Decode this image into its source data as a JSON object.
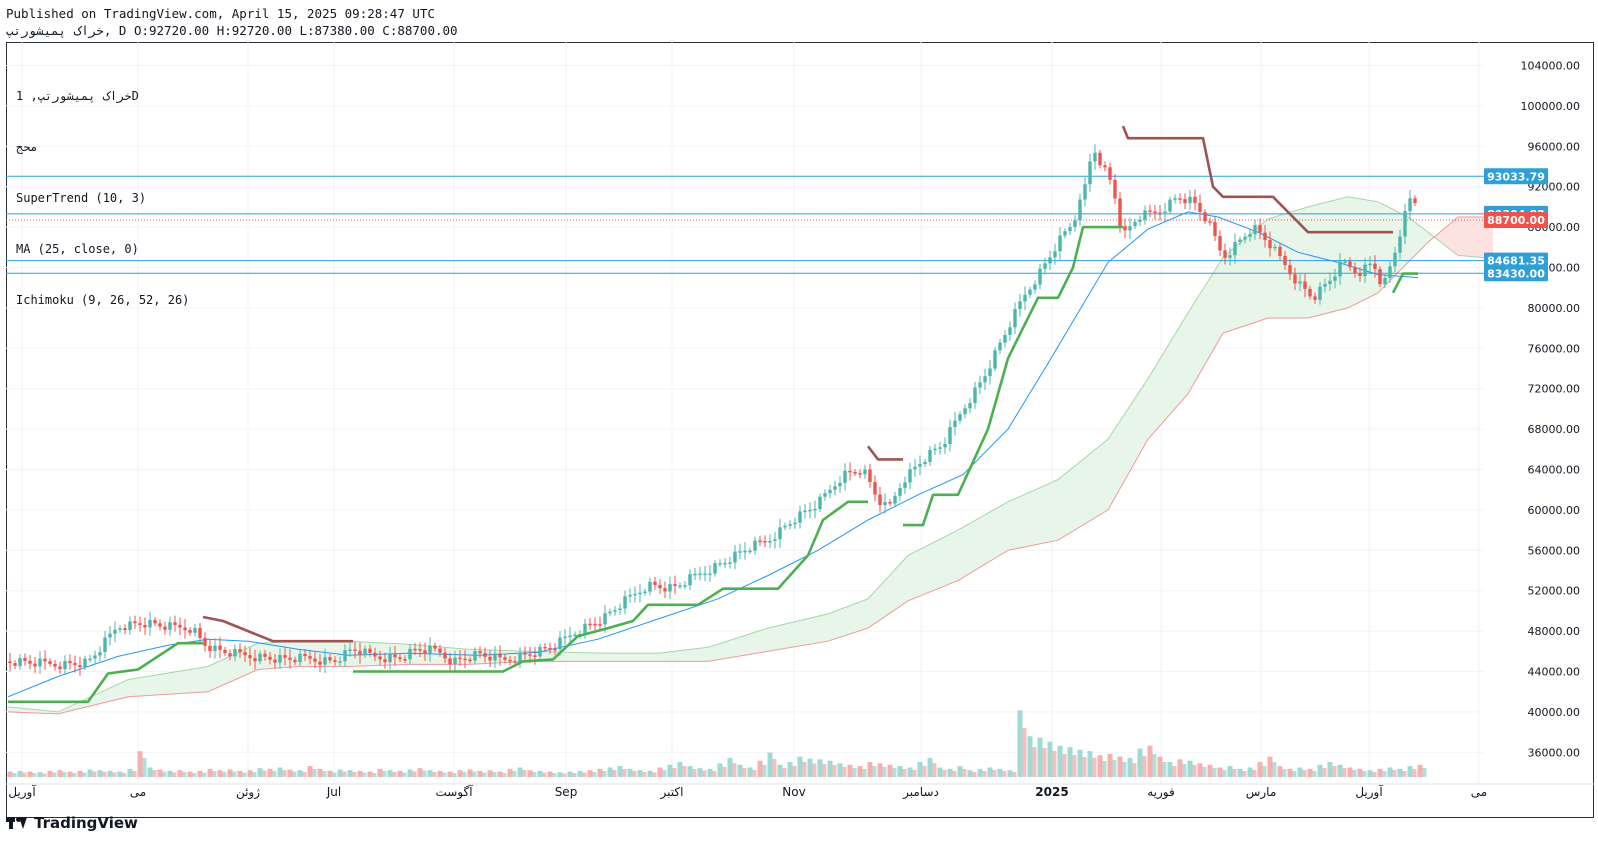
{
  "header": {
    "published": "Published on TradingView.com, April 15, 2025 09:28:47 UTC",
    "ohlc": "خراک پمیشورتپ, D O:92720.00 H:92720.00 L:87380.00 C:88700.00"
  },
  "legend": {
    "symbol": "خراک پمیشورتپ, 1D",
    "symbol_sub": "محج",
    "indicators": [
      "SuperTrend (10, 3)",
      "MA (25, close, 0)",
      "Ichimoku (9, 26, 52, 26)"
    ]
  },
  "footer": {
    "brand": "TradingView"
  },
  "colors": {
    "up": "#4db6ac",
    "down": "#ef5350",
    "supertrend_up": "#4caf50",
    "supertrend_down": "#a05353",
    "ma": "#2196f3",
    "hline": "#2f9fd8",
    "cloud_green": "#e8f5e9",
    "cloud_red": "#fde2e2"
  },
  "chart_data": {
    "type": "candlestick",
    "y_ticks": [
      104000,
      100000,
      96000,
      92000,
      88000,
      84000,
      80000,
      76000,
      72000,
      68000,
      64000,
      60000,
      56000,
      52000,
      48000,
      44000,
      40000,
      36000
    ],
    "x_labels": [
      "آوریل",
      "می",
      "ژوئن",
      "Jul",
      "آگوست",
      "Sep",
      "اکتبر",
      "Nov",
      "دسامبر",
      "2025",
      "فوریه",
      "مارس",
      "آوریل",
      "می"
    ],
    "horizontal_lines": [
      {
        "value": 93033.79,
        "label": "93033.79"
      },
      {
        "value": 89304.82,
        "label": "89304.82"
      },
      {
        "value": 84681.35,
        "label": "84681.35"
      },
      {
        "value": 83430.0,
        "label": "83430.00"
      }
    ],
    "last_price": {
      "value": 88700.0,
      "label": "88700.00"
    },
    "last_candle": {
      "open": 92720.0,
      "high": 92720.0,
      "low": 87380.0,
      "close": 88700.0
    },
    "close_series": [
      [
        0,
        45000
      ],
      [
        30,
        44800
      ],
      [
        55,
        44700
      ],
      [
        80,
        44900
      ],
      [
        90,
        46000
      ],
      [
        110,
        48500
      ],
      [
        135,
        48800
      ],
      [
        160,
        48400
      ],
      [
        185,
        48300
      ],
      [
        195,
        46800
      ],
      [
        210,
        46000
      ],
      [
        230,
        45700
      ],
      [
        255,
        45400
      ],
      [
        275,
        45200
      ],
      [
        300,
        45300
      ],
      [
        325,
        45000
      ],
      [
        345,
        46200
      ],
      [
        365,
        45500
      ],
      [
        390,
        45300
      ],
      [
        410,
        46200
      ],
      [
        430,
        46000
      ],
      [
        445,
        45000
      ],
      [
        470,
        45700
      ],
      [
        495,
        45100
      ],
      [
        520,
        45700
      ],
      [
        545,
        46400
      ],
      [
        570,
        48100
      ],
      [
        595,
        49200
      ],
      [
        620,
        51200
      ],
      [
        640,
        52600
      ],
      [
        665,
        52200
      ],
      [
        690,
        53600
      ],
      [
        715,
        54800
      ],
      [
        740,
        56200
      ],
      [
        760,
        57000
      ],
      [
        785,
        59000
      ],
      [
        810,
        60600
      ],
      [
        835,
        63500
      ],
      [
        855,
        64000
      ],
      [
        870,
        61000
      ],
      [
        880,
        60000
      ],
      [
        895,
        63000
      ],
      [
        915,
        65000
      ],
      [
        935,
        66500
      ],
      [
        955,
        70000
      ],
      [
        975,
        73000
      ],
      [
        995,
        77000
      ],
      [
        1015,
        81000
      ],
      [
        1035,
        84000
      ],
      [
        1050,
        86500
      ],
      [
        1065,
        88500
      ],
      [
        1075,
        91000
      ],
      [
        1085,
        96000
      ],
      [
        1095,
        94000
      ],
      [
        1105,
        92000
      ],
      [
        1115,
        87000
      ],
      [
        1130,
        89000
      ],
      [
        1150,
        89500
      ],
      [
        1170,
        91000
      ],
      [
        1185,
        90500
      ],
      [
        1200,
        88500
      ],
      [
        1215,
        85000
      ],
      [
        1230,
        86500
      ],
      [
        1245,
        88000
      ],
      [
        1260,
        86500
      ],
      [
        1275,
        84500
      ],
      [
        1290,
        82500
      ],
      [
        1305,
        81000
      ],
      [
        1320,
        82500
      ],
      [
        1335,
        84500
      ],
      [
        1350,
        83500
      ],
      [
        1365,
        84500
      ],
      [
        1375,
        82000
      ],
      [
        1385,
        84800
      ],
      [
        1395,
        88500
      ],
      [
        1405,
        91500
      ],
      [
        1410,
        88700
      ]
    ],
    "supertrend": [
      {
        "dir": "up",
        "points": [
          [
            0,
            41000
          ],
          [
            80,
            41000
          ],
          [
            100,
            43800
          ],
          [
            130,
            44200
          ],
          [
            170,
            46800
          ],
          [
            195,
            46800
          ]
        ]
      },
      {
        "dir": "down",
        "points": [
          [
            195,
            49400
          ],
          [
            215,
            49000
          ],
          [
            265,
            47000
          ],
          [
            345,
            47000
          ]
        ]
      },
      {
        "dir": "up",
        "points": [
          [
            345,
            44000
          ],
          [
            495,
            44000
          ],
          [
            515,
            45000
          ],
          [
            545,
            45200
          ],
          [
            570,
            47500
          ],
          [
            600,
            48300
          ],
          [
            625,
            49000
          ],
          [
            640,
            50600
          ],
          [
            690,
            50600
          ],
          [
            715,
            52200
          ],
          [
            770,
            52200
          ],
          [
            800,
            55500
          ],
          [
            815,
            59000
          ],
          [
            840,
            60800
          ],
          [
            860,
            60800
          ]
        ]
      },
      {
        "dir": "down",
        "points": [
          [
            860,
            66300
          ],
          [
            870,
            65000
          ],
          [
            895,
            65000
          ]
        ]
      },
      {
        "dir": "up",
        "points": [
          [
            895,
            58500
          ],
          [
            915,
            58500
          ],
          [
            925,
            61500
          ],
          [
            950,
            61500
          ],
          [
            980,
            68000
          ],
          [
            1000,
            75000
          ],
          [
            1030,
            81000
          ],
          [
            1050,
            81000
          ],
          [
            1065,
            84000
          ],
          [
            1075,
            88000
          ],
          [
            1085,
            88000
          ],
          [
            1115,
            88000
          ]
        ]
      },
      {
        "dir": "down",
        "points": [
          [
            1115,
            98000
          ],
          [
            1120,
            96800
          ],
          [
            1195,
            96800
          ],
          [
            1205,
            92000
          ],
          [
            1215,
            91000
          ],
          [
            1265,
            91000
          ],
          [
            1290,
            88500
          ],
          [
            1300,
            87500
          ],
          [
            1385,
            87500
          ]
        ]
      },
      {
        "dir": "up",
        "points": [
          [
            1385,
            81500
          ],
          [
            1395,
            83400
          ],
          [
            1410,
            83400
          ]
        ]
      }
    ],
    "ma_series": [
      [
        0,
        41500
      ],
      [
        50,
        43500
      ],
      [
        110,
        45500
      ],
      [
        160,
        46600
      ],
      [
        200,
        47200
      ],
      [
        240,
        47000
      ],
      [
        290,
        46200
      ],
      [
        340,
        45600
      ],
      [
        400,
        45800
      ],
      [
        470,
        45600
      ],
      [
        530,
        45900
      ],
      [
        590,
        47200
      ],
      [
        650,
        49200
      ],
      [
        710,
        51200
      ],
      [
        760,
        53500
      ],
      [
        810,
        56000
      ],
      [
        860,
        59000
      ],
      [
        910,
        61500
      ],
      [
        955,
        63500
      ],
      [
        1000,
        68000
      ],
      [
        1040,
        74500
      ],
      [
        1070,
        79500
      ],
      [
        1100,
        84500
      ],
      [
        1140,
        87800
      ],
      [
        1180,
        89500
      ],
      [
        1210,
        89000
      ],
      [
        1250,
        87500
      ],
      [
        1290,
        85500
      ],
      [
        1330,
        84500
      ],
      [
        1370,
        83300
      ],
      [
        1410,
        83000
      ]
    ],
    "ichimoku_cloud": {
      "span_a": [
        [
          0,
          40500
        ],
        [
          50,
          40000
        ],
        [
          120,
          43200
        ],
        [
          200,
          44500
        ],
        [
          250,
          46800
        ],
        [
          290,
          47000
        ],
        [
          340,
          47000
        ],
        [
          400,
          46700
        ],
        [
          460,
          46200
        ],
        [
          520,
          46000
        ],
        [
          600,
          45800
        ],
        [
          650,
          45800
        ],
        [
          700,
          46400
        ],
        [
          760,
          48300
        ],
        [
          820,
          49700
        ],
        [
          860,
          51200
        ],
        [
          900,
          55500
        ],
        [
          950,
          58000
        ],
        [
          1000,
          60800
        ],
        [
          1050,
          63000
        ],
        [
          1100,
          67000
        ],
        [
          1140,
          73000
        ],
        [
          1180,
          79500
        ],
        [
          1215,
          85000
        ],
        [
          1260,
          88800
        ],
        [
          1300,
          90000
        ],
        [
          1340,
          91000
        ],
        [
          1370,
          90500
        ],
        [
          1400,
          89000
        ],
        [
          1420,
          87500
        ],
        [
          1450,
          85200
        ],
        [
          1485,
          84900
        ]
      ],
      "span_b": [
        [
          0,
          40000
        ],
        [
          50,
          39800
        ],
        [
          120,
          41500
        ],
        [
          200,
          42000
        ],
        [
          250,
          44200
        ],
        [
          290,
          44500
        ],
        [
          340,
          44500
        ],
        [
          400,
          44700
        ],
        [
          460,
          44700
        ],
        [
          520,
          45000
        ],
        [
          600,
          45000
        ],
        [
          650,
          45000
        ],
        [
          700,
          45000
        ],
        [
          760,
          46000
        ],
        [
          820,
          47000
        ],
        [
          860,
          48300
        ],
        [
          900,
          51000
        ],
        [
          950,
          53000
        ],
        [
          1000,
          56000
        ],
        [
          1050,
          57000
        ],
        [
          1100,
          60000
        ],
        [
          1140,
          67000
        ],
        [
          1180,
          71500
        ],
        [
          1215,
          77500
        ],
        [
          1260,
          79000
        ],
        [
          1300,
          79000
        ],
        [
          1340,
          80000
        ],
        [
          1370,
          81500
        ],
        [
          1400,
          84500
        ],
        [
          1420,
          86500
        ],
        [
          1450,
          89000
        ],
        [
          1485,
          89000
        ]
      ]
    },
    "volume": [
      8,
      9,
      8,
      7,
      9,
      10,
      8,
      9,
      11,
      10,
      9,
      8,
      12,
      38,
      14,
      11,
      9,
      10,
      8,
      9,
      12,
      10,
      11,
      9,
      10,
      13,
      12,
      14,
      11,
      10,
      16,
      12,
      9,
      11,
      10,
      9,
      8,
      12,
      10,
      9,
      11,
      13,
      10,
      9,
      8,
      10,
      11,
      9,
      10,
      8,
      12,
      14,
      10,
      9,
      8,
      7,
      8,
      9,
      10,
      12,
      14,
      16,
      12,
      10,
      9,
      14,
      18,
      22,
      16,
      13,
      12,
      20,
      28,
      18,
      14,
      24,
      36,
      18,
      22,
      30,
      27,
      26,
      24,
      20,
      18,
      16,
      22,
      20,
      18,
      16,
      14,
      22,
      28,
      14,
      12,
      16,
      10,
      12,
      14,
      12,
      10,
      98,
      60,
      58,
      52,
      46,
      44,
      40,
      38,
      32,
      34,
      30,
      28,
      42,
      46,
      30,
      22,
      26,
      24,
      20,
      18,
      14,
      16,
      12,
      14,
      22,
      30,
      16,
      12,
      14,
      12,
      18,
      22,
      18,
      14,
      12,
      10,
      12,
      14,
      12,
      16,
      18
    ]
  }
}
